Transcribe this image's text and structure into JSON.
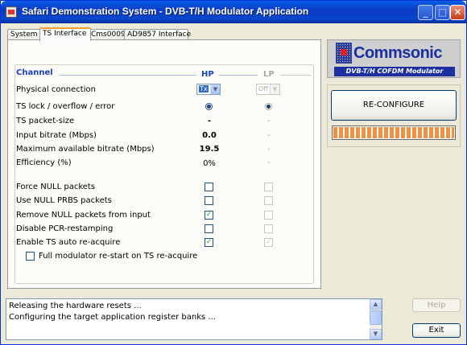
{
  "window": {
    "title": "Safari Demonstration System - DVB-T/H Modulator Application"
  },
  "tabs": [
    {
      "label": "System"
    },
    {
      "label": "TS Interface"
    },
    {
      "label": "Cms0009"
    },
    {
      "label": "AD9857 Interface"
    }
  ],
  "ts": {
    "channel_label": "Channel",
    "hp_label": "HP",
    "lp_label": "LP",
    "rows": {
      "physical": {
        "label": "Physical connection",
        "hp": "Tx",
        "lp": "Off"
      },
      "lock": {
        "label": "TS lock / overflow / error"
      },
      "packet": {
        "label": "TS packet-size",
        "hp": "-",
        "lp": "-"
      },
      "input": {
        "label": "Input bitrate (Mbps)",
        "hp": "0.0",
        "lp": "-"
      },
      "max": {
        "label": "Maximum available bitrate (Mbps)",
        "hp": "19.5",
        "lp": "-"
      },
      "eff": {
        "label": "Efficiency (%)",
        "hp": "0%",
        "lp": "-"
      }
    },
    "options": [
      {
        "label": "Force NULL packets",
        "hp": false,
        "lp": false
      },
      {
        "label": "Use NULL PRBS packets",
        "hp": false,
        "lp": false
      },
      {
        "label": "Remove NULL packets from input",
        "hp": true,
        "lp": false
      },
      {
        "label": "Disable PCR-restamping",
        "hp": false,
        "lp": false
      },
      {
        "label": "Enable TS auto re-acquire",
        "hp": true,
        "lp": true
      }
    ],
    "full_restart": {
      "label": "Full modulator re-start on TS re-acquire",
      "checked": false
    }
  },
  "logo": {
    "name": "Commsonic",
    "subtitle": "DVB-T/H COFDM Modulator"
  },
  "reconfigure": {
    "label": "RE-CONFIGURE",
    "progress": 1.0
  },
  "log": {
    "lines": [
      "Releasing the hardware resets ...",
      "Configuring the target application register banks ..."
    ]
  },
  "buttons": {
    "help": "Help",
    "exit": "Exit"
  },
  "colors": {
    "title_bar": "#0a3cc4",
    "channel_text": "#1a40c0",
    "progress": "#f09040",
    "check": "#21a121"
  }
}
